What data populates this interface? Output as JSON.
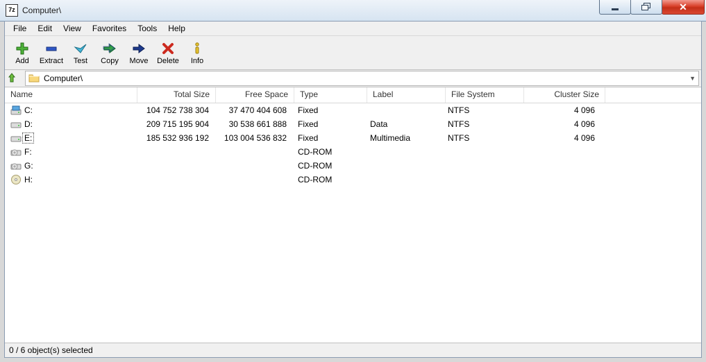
{
  "window": {
    "title": "Computer\\",
    "icon_text": "7z"
  },
  "menu": [
    "File",
    "Edit",
    "View",
    "Favorites",
    "Tools",
    "Help"
  ],
  "toolbar": [
    {
      "id": "add",
      "label": "Add",
      "icon": "plus"
    },
    {
      "id": "extract",
      "label": "Extract",
      "icon": "minus"
    },
    {
      "id": "test",
      "label": "Test",
      "icon": "check"
    },
    {
      "id": "copy",
      "label": "Copy",
      "icon": "arrow-rd"
    },
    {
      "id": "move",
      "label": "Move",
      "icon": "arrow-r"
    },
    {
      "id": "delete",
      "label": "Delete",
      "icon": "cross"
    },
    {
      "id": "info",
      "label": "Info",
      "icon": "info"
    }
  ],
  "path": "Computer\\",
  "columns": [
    "Name",
    "Total Size",
    "Free Space",
    "Type",
    "Label",
    "File System",
    "Cluster Size"
  ],
  "rows": [
    {
      "name": "C:",
      "icon": "hdd-c",
      "total": "104 752 738 304",
      "free": "37 470 404 608",
      "type": "Fixed",
      "label": "",
      "fs": "NTFS",
      "cluster": "4 096",
      "focused": false
    },
    {
      "name": "D:",
      "icon": "hdd",
      "total": "209 715 195 904",
      "free": "30 538 661 888",
      "type": "Fixed",
      "label": "Data",
      "fs": "NTFS",
      "cluster": "4 096",
      "focused": false
    },
    {
      "name": "E:",
      "icon": "hdd",
      "total": "185 532 936 192",
      "free": "103 004 536 832",
      "type": "Fixed",
      "label": "Multimedia",
      "fs": "NTFS",
      "cluster": "4 096",
      "focused": true
    },
    {
      "name": "F:",
      "icon": "cd",
      "total": "",
      "free": "",
      "type": "CD-ROM",
      "label": "",
      "fs": "",
      "cluster": "",
      "focused": false
    },
    {
      "name": "G:",
      "icon": "cd",
      "total": "",
      "free": "",
      "type": "CD-ROM",
      "label": "",
      "fs": "",
      "cluster": "",
      "focused": false
    },
    {
      "name": "H:",
      "icon": "cd2",
      "total": "",
      "free": "",
      "type": "CD-ROM",
      "label": "",
      "fs": "",
      "cluster": "",
      "focused": false
    }
  ],
  "status": "0 / 6 object(s) selected"
}
